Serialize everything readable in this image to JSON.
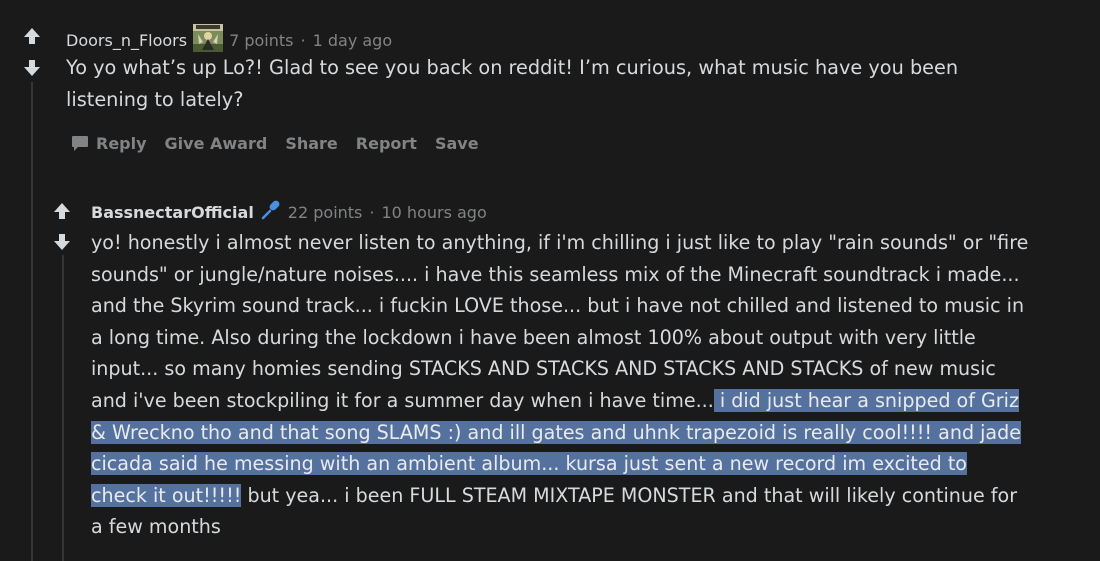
{
  "comments": [
    {
      "author": "Doors_n_Floors",
      "avatar_icon": "game-character-avatar-icon",
      "points": "7 points",
      "separator": "·",
      "time": "1 day ago",
      "lines": [
        "Yo yo what’s up Lo?! Glad to see you back on reddit! I’m curious, what music have you been",
        "listening to lately?"
      ],
      "actions": {
        "reply": "Reply",
        "give_award": "Give Award",
        "share": "Share",
        "report": "Report",
        "save": "Save"
      }
    },
    {
      "author": "BassnectarOfficial",
      "flair_icon": "microphone-icon",
      "points": "22 points",
      "separator": "·",
      "time": "10 hours ago",
      "line1": "yo! honestly i almost never listen to anything, if i'm chilling i just like to play \"rain sounds\" or \"fire",
      "line2": "sounds\" or jungle/nature noises.... i have this seamless mix of the Minecraft soundtrack i made...",
      "line3": "and the Skyrim sound track... i fuckin LOVE those... but i have not chilled and listened to music in",
      "line4": "a long time. Also during the lockdown i have been almost 100% about output with very little",
      "line5": "input... so many homies sending STACKS AND STACKS AND STACKS AND STACKS of new music",
      "line6_plain": "and i've been stockpiling it for a summer day when i have time...",
      "line6_hl": " i did just hear a snipped of Griz",
      "line7_hl": "& Wreckno tho and that song SLAMS :) and ill gates and uhnk trapezoid is really cool!!!! and jade",
      "line8_hl": "cicada said he messing with an ambient album... kursa just sent a new record im excited to",
      "line9_hl": "check it out!!!!!",
      "line9_plain": " but yea... i been FULL STEAM MIXTAPE MONSTER and that will likely continue for",
      "line10": "a few months"
    }
  ],
  "colors": {
    "background": "#1a1a1b",
    "text": "#d7dadc",
    "muted": "#818384",
    "selection": "#55729f",
    "flair_blue": "#4a90e2"
  }
}
